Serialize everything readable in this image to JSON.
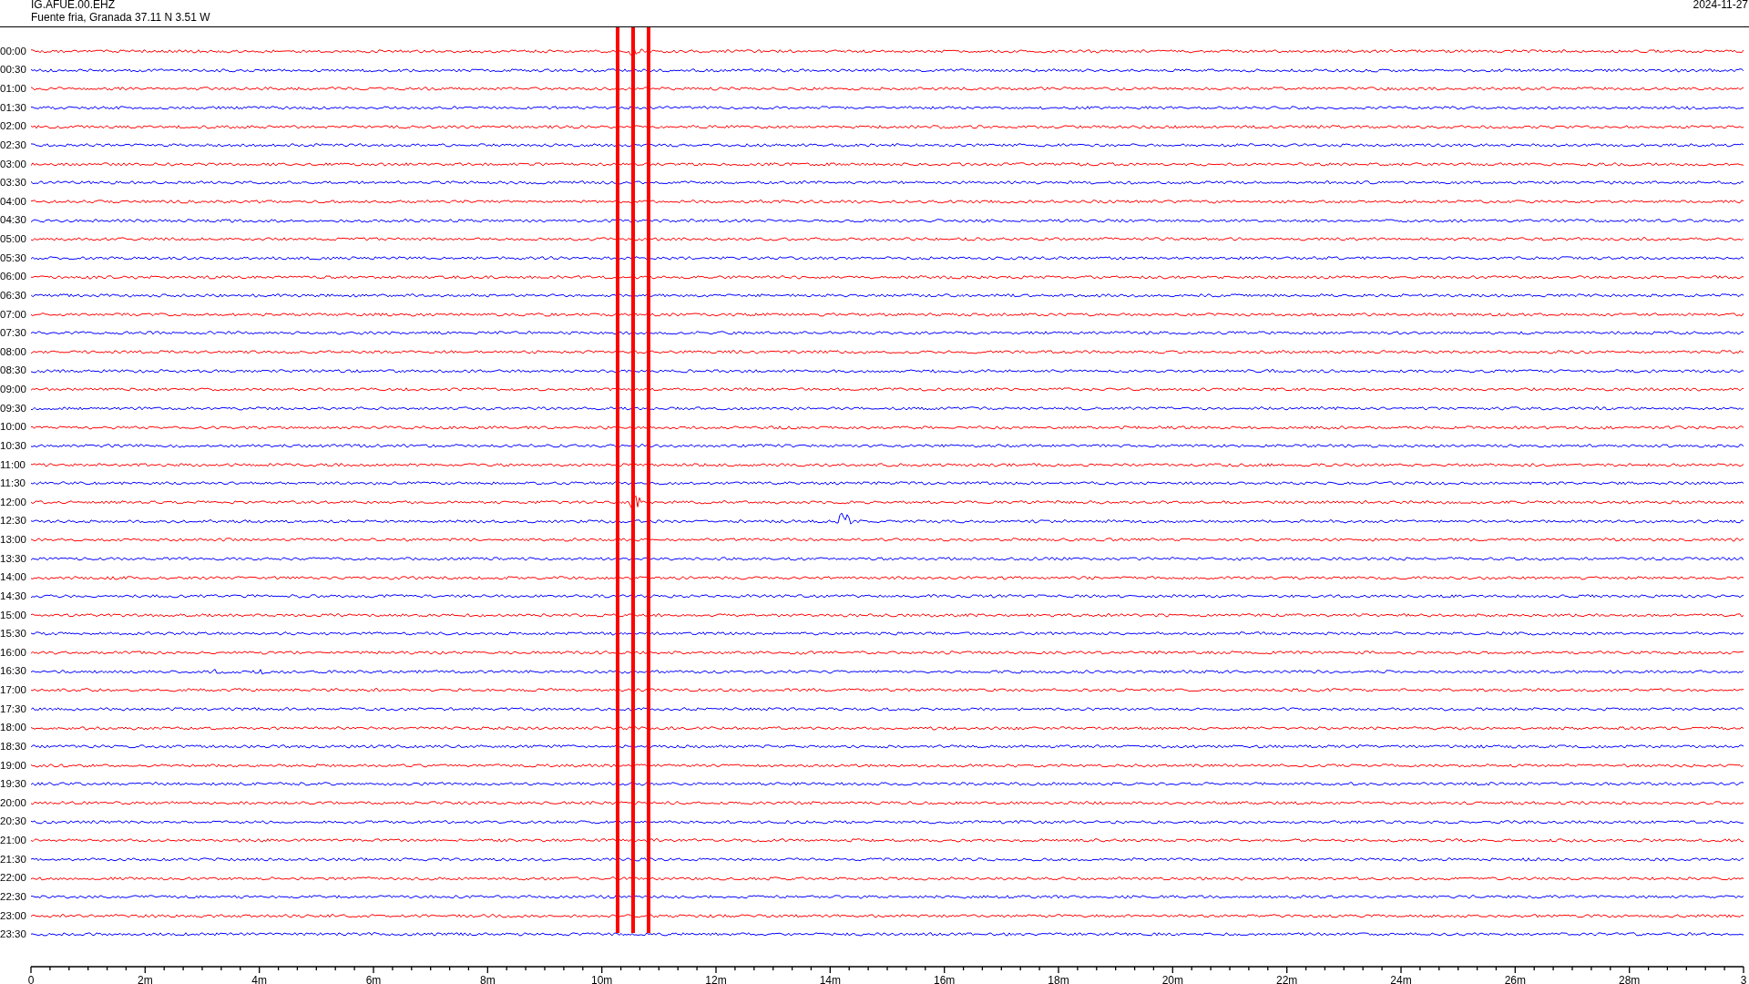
{
  "header": {
    "station": "IG.AFUE.00.EHZ",
    "location": "Fuente fria, Granada  37.11 N 3.51 W",
    "date": "2024-11-27"
  },
  "helicorder": {
    "rows": [
      {
        "time": "00:00",
        "color": "#ff0000"
      },
      {
        "time": "00:30",
        "color": "#0000ff"
      },
      {
        "time": "01:00",
        "color": "#ff0000"
      },
      {
        "time": "01:30",
        "color": "#0000ff"
      },
      {
        "time": "02:00",
        "color": "#ff0000"
      },
      {
        "time": "02:30",
        "color": "#0000ff"
      },
      {
        "time": "03:00",
        "color": "#ff0000"
      },
      {
        "time": "03:30",
        "color": "#0000ff"
      },
      {
        "time": "04:00",
        "color": "#ff0000"
      },
      {
        "time": "04:30",
        "color": "#0000ff"
      },
      {
        "time": "05:00",
        "color": "#ff0000"
      },
      {
        "time": "05:30",
        "color": "#0000ff"
      },
      {
        "time": "06:00",
        "color": "#ff0000"
      },
      {
        "time": "06:30",
        "color": "#0000ff"
      },
      {
        "time": "07:00",
        "color": "#ff0000"
      },
      {
        "time": "07:30",
        "color": "#0000ff"
      },
      {
        "time": "08:00",
        "color": "#ff0000"
      },
      {
        "time": "08:30",
        "color": "#0000ff"
      },
      {
        "time": "09:00",
        "color": "#ff0000"
      },
      {
        "time": "09:30",
        "color": "#0000ff"
      },
      {
        "time": "10:00",
        "color": "#ff0000"
      },
      {
        "time": "10:30",
        "color": "#0000ff"
      },
      {
        "time": "11:00",
        "color": "#ff0000"
      },
      {
        "time": "11:30",
        "color": "#0000ff"
      },
      {
        "time": "12:00",
        "color": "#ff0000"
      },
      {
        "time": "12:30",
        "color": "#0000ff"
      },
      {
        "time": "13:00",
        "color": "#ff0000"
      },
      {
        "time": "13:30",
        "color": "#0000ff"
      },
      {
        "time": "14:00",
        "color": "#ff0000"
      },
      {
        "time": "14:30",
        "color": "#0000ff"
      },
      {
        "time": "15:00",
        "color": "#ff0000"
      },
      {
        "time": "15:30",
        "color": "#0000ff"
      },
      {
        "time": "16:00",
        "color": "#ff0000"
      },
      {
        "time": "16:30",
        "color": "#0000ff"
      },
      {
        "time": "17:00",
        "color": "#ff0000"
      },
      {
        "time": "17:30",
        "color": "#0000ff"
      },
      {
        "time": "18:00",
        "color": "#ff0000"
      },
      {
        "time": "18:30",
        "color": "#0000ff"
      },
      {
        "time": "19:00",
        "color": "#ff0000"
      },
      {
        "time": "19:30",
        "color": "#0000ff"
      },
      {
        "time": "20:00",
        "color": "#ff0000"
      },
      {
        "time": "20:30",
        "color": "#0000ff"
      },
      {
        "time": "21:00",
        "color": "#ff0000"
      },
      {
        "time": "21:30",
        "color": "#0000ff"
      },
      {
        "time": "22:00",
        "color": "#ff0000"
      },
      {
        "time": "22:30",
        "color": "#0000ff"
      },
      {
        "time": "23:00",
        "color": "#ff0000"
      },
      {
        "time": "23:30",
        "color": "#0000ff"
      }
    ],
    "x_axis": {
      "labels": [
        "0",
        "2m",
        "4m",
        "6m",
        "8m",
        "10m",
        "12m",
        "14m",
        "16m",
        "18m",
        "20m",
        "22m",
        "24m",
        "26m",
        "28m",
        "3"
      ]
    }
  }
}
